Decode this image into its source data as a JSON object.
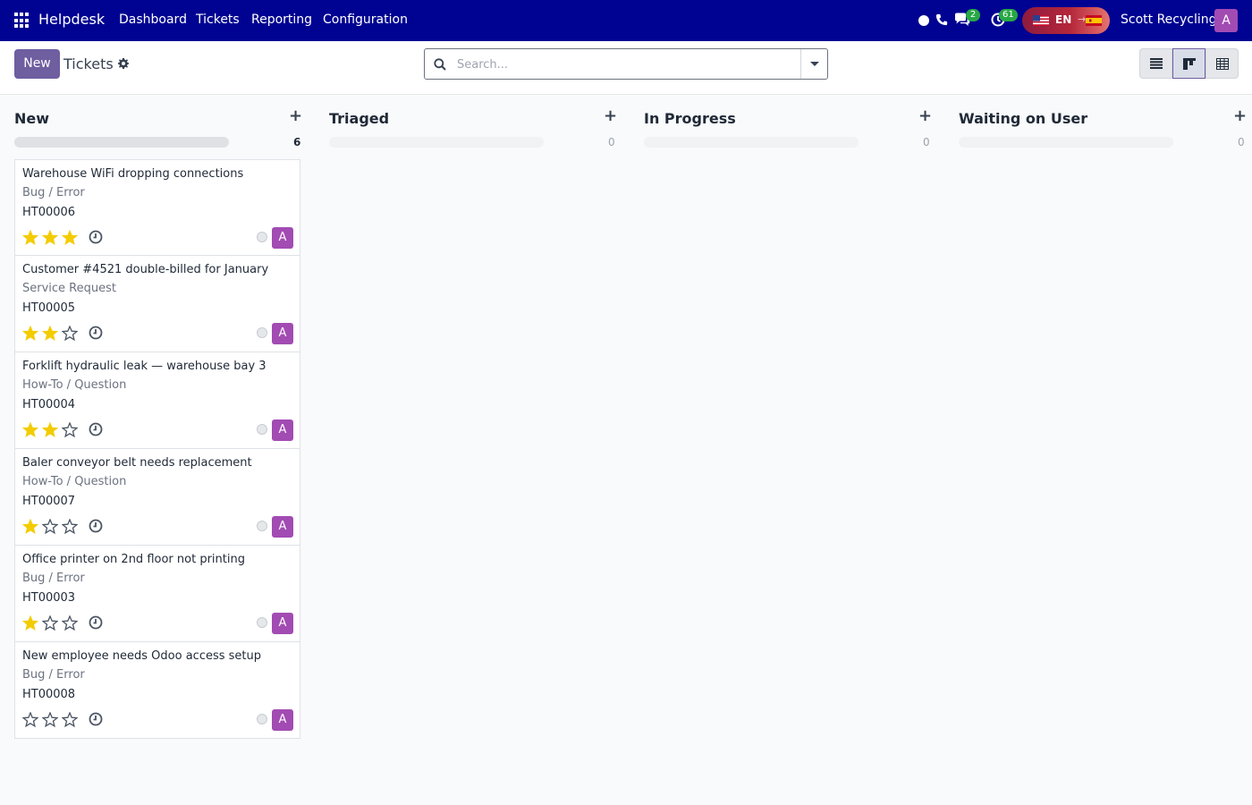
{
  "navbar": {
    "app_name": "Helpdesk",
    "menu": [
      "Dashboard",
      "Tickets",
      "Reporting",
      "Configuration"
    ],
    "chat_badge": "2",
    "activity_badge": "61",
    "lang": {
      "code": "EN",
      "arrow": "→"
    },
    "company": "Scott Recycling",
    "avatar": "A"
  },
  "control": {
    "new_label": "New",
    "breadcrumb": "Tickets",
    "search_placeholder": "Search..."
  },
  "columns": [
    {
      "title": "New",
      "count": "6"
    },
    {
      "title": "Triaged",
      "count": "0"
    },
    {
      "title": "In Progress",
      "count": "0"
    },
    {
      "title": "Waiting on User",
      "count": "0"
    }
  ],
  "cards": [
    {
      "title": "Warehouse WiFi dropping connections",
      "tag": "Bug / Error",
      "ref": "HT00006",
      "priority": 3,
      "assignee": "A"
    },
    {
      "title": "Customer #4521 double-billed for January",
      "tag": "Service Request",
      "ref": "HT00005",
      "priority": 2,
      "assignee": "A"
    },
    {
      "title": "Forklift hydraulic leak — warehouse bay 3",
      "tag": "How-To / Question",
      "ref": "HT00004",
      "priority": 2,
      "assignee": "A"
    },
    {
      "title": "Baler conveyor belt needs replacement",
      "tag": "How-To / Question",
      "ref": "HT00007",
      "priority": 1,
      "assignee": "A"
    },
    {
      "title": "Office printer on 2nd floor not printing",
      "tag": "Bug / Error",
      "ref": "HT00003",
      "priority": 1,
      "assignee": "A"
    },
    {
      "title": "New employee needs Odoo access setup",
      "tag": "Bug / Error",
      "ref": "HT00008",
      "priority": 0,
      "assignee": "A"
    }
  ],
  "colors": {
    "navbar": "#000391",
    "primary": "#6f5ea0",
    "avatar": "#a24bb3",
    "star": "#f3cc00",
    "badge": "#28a745"
  },
  "icons": [
    "apps-icon",
    "status-dot-icon",
    "phone-icon",
    "chat-icon",
    "activity-clock-icon",
    "us-flag-icon",
    "es-flag-icon",
    "gear-icon",
    "search-icon",
    "list-view-icon",
    "kanban-view-icon",
    "pivot-view-icon",
    "star-icon",
    "clock-icon"
  ]
}
